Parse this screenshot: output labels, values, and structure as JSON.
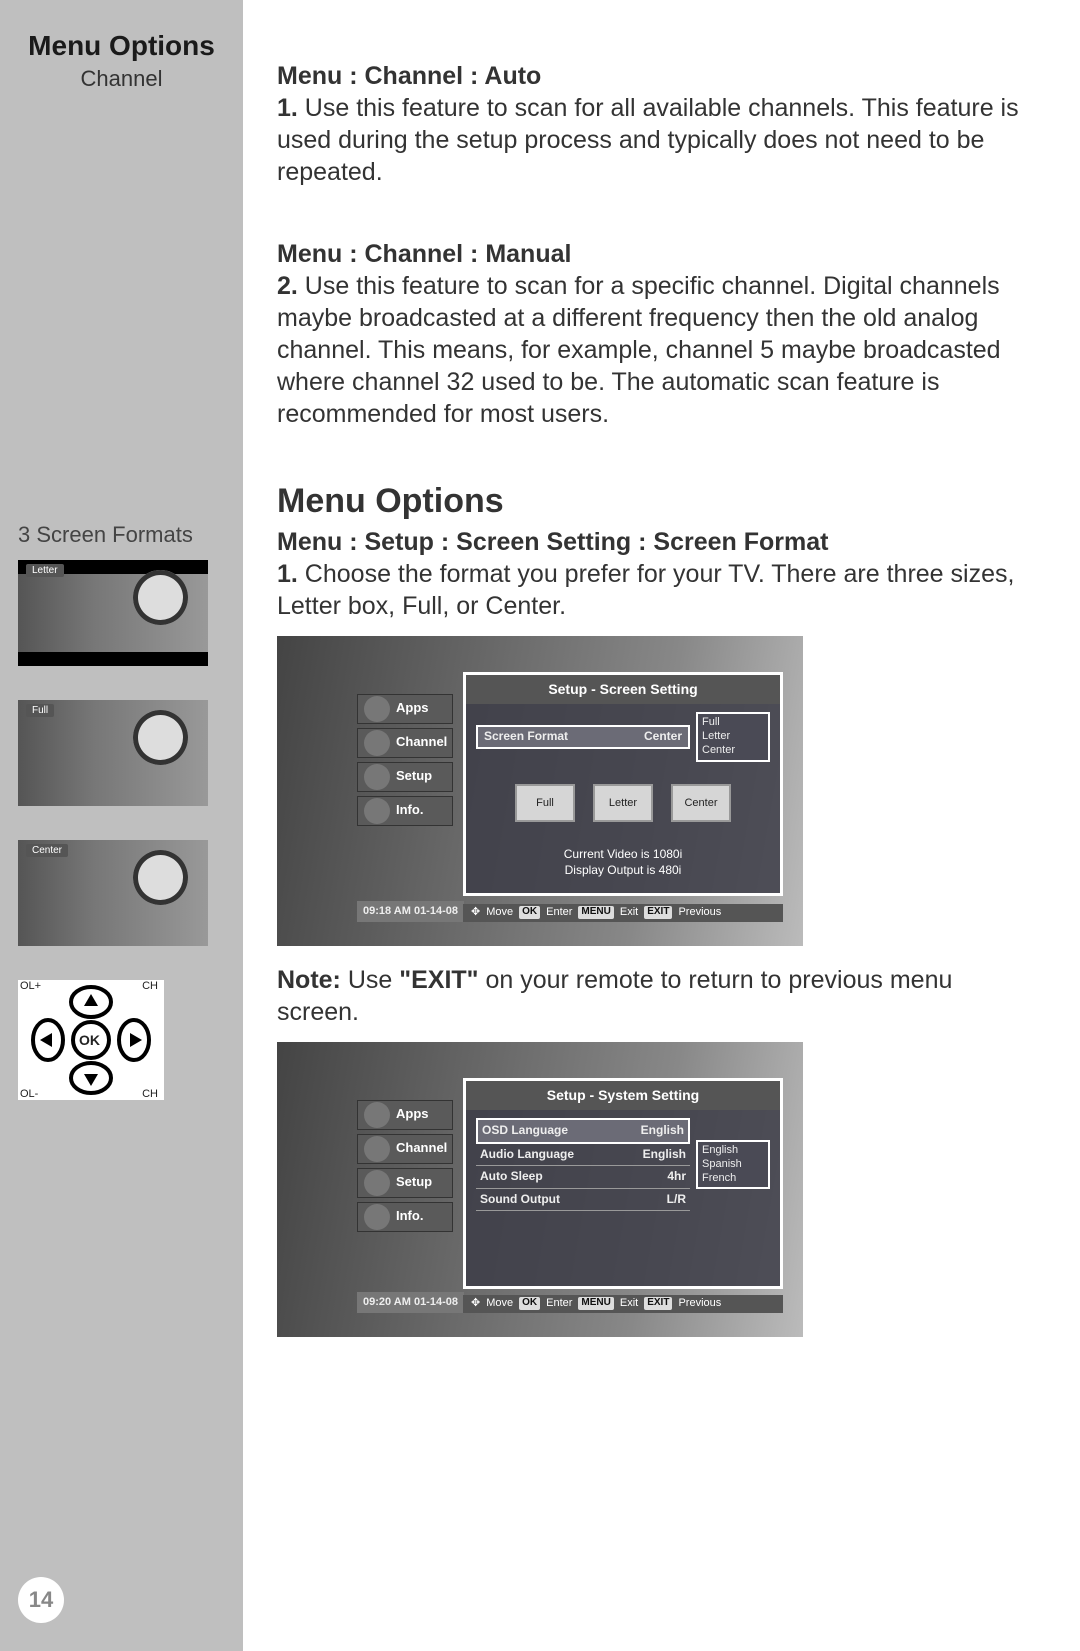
{
  "sidebar": {
    "title": "Menu Options",
    "subtitle": "Channel",
    "formats_label": "3 Screen Formats",
    "thumbs": [
      {
        "tag": "Letter"
      },
      {
        "tag": "Full"
      },
      {
        "tag": "Center"
      }
    ],
    "remote": {
      "ok": "OK",
      "vol_plus": "OL+",
      "vol_minus": "OL-",
      "ch": "CH"
    },
    "page_number": "14"
  },
  "content": {
    "auto": {
      "heading": "Menu : Channel : Auto",
      "num": "1.",
      "text": " Use this feature to scan for all available channels. This feature is used during the setup process and typically does not need to be repeated."
    },
    "manual": {
      "heading": "Menu : Channel : Manual",
      "num": "2.",
      "text": " Use this feature to scan for a specific channel. Digital channels maybe broadcasted at a different frequency then the old analog channel. This means, for example, channel 5 maybe broadcasted where channel 32 used to be. The automatic scan feature is recommended for most users."
    },
    "section_title": "Menu Options",
    "screenformat": {
      "heading": "Menu : Setup : Screen Setting : Screen Format",
      "num": "1.",
      "text": " Choose the format you prefer for your TV. There are three sizes, Letter box, Full, or Center."
    },
    "note": {
      "label": "Note:",
      "mid": " Use ",
      "exit": "\"EXIT\"",
      "rest": " on your remote to return to previous menu screen."
    }
  },
  "osd_menu": {
    "items": [
      "Apps",
      "Channel",
      "Setup",
      "Info."
    ]
  },
  "shot1": {
    "panel_title": "Setup - Screen Setting",
    "field_label": "Screen Format",
    "field_value": "Center",
    "options": [
      "Full",
      "Letter",
      "Center"
    ],
    "buttons": [
      "Full",
      "Letter",
      "Center"
    ],
    "status_line1": "Current Video is 1080i",
    "status_line2": "Display Output is 480i",
    "timestamp": "09:18 AM 01-14-08",
    "help": {
      "move": "Move",
      "enter": "Enter",
      "exit": "Exit",
      "prev": "Previous",
      "k_ok": "OK",
      "k_menu": "MENU",
      "k_exit": "EXIT"
    }
  },
  "shot2": {
    "panel_title": "Setup - System Setting",
    "rows": [
      {
        "label": "OSD Language",
        "value": "English",
        "selected": true
      },
      {
        "label": "Audio Language",
        "value": "English"
      },
      {
        "label": "Auto Sleep",
        "value": "4hr"
      },
      {
        "label": "Sound Output",
        "value": "L/R"
      }
    ],
    "options": [
      "English",
      "Spanish",
      "French"
    ],
    "timestamp": "09:20 AM 01-14-08",
    "help": {
      "move": "Move",
      "enter": "Enter",
      "exit": "Exit",
      "prev": "Previous",
      "k_ok": "OK",
      "k_menu": "MENU",
      "k_exit": "EXIT"
    }
  }
}
